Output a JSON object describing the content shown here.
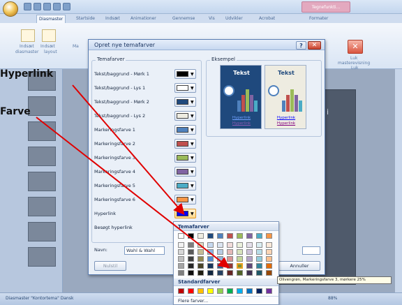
{
  "app": {
    "contextual_tab": "Tegnefunkti...",
    "tabs": [
      "Diasmaster",
      "Startside",
      "Indsæt",
      "Animationer",
      "Gennemse",
      "Vis",
      "Udvikler",
      "Acrobat",
      "Formater"
    ],
    "ribbon_items": {
      "insert_1": "Indsæt",
      "insert_2": "Indsæt",
      "diasmaster": "diasmaster",
      "layout": "layout",
      "ma": "Ma",
      "close_line1": "Luk",
      "close_line2": "masterevisning",
      "close_group": "Luk"
    },
    "slide_label": "ii",
    "status": {
      "left": "Diasmaster  \"Kontortema\"  Dansk",
      "zoom": "88%"
    }
  },
  "dialog": {
    "title": "Opret nye temafarver",
    "help": "?",
    "close": "✕",
    "temafarver_label": "Temafarver",
    "eksempel_label": "Eksempel",
    "rows": [
      {
        "label": "Tekst/baggrund - Mørk 1",
        "color": "#000000"
      },
      {
        "label": "Tekst/baggrund - Lys 1",
        "color": "#ffffff"
      },
      {
        "label": "Tekst/baggrund - Mørk 2",
        "color": "#1f497d"
      },
      {
        "label": "Tekst/baggrund - Lys 2",
        "color": "#eeece1"
      },
      {
        "label": "Markeringsfarve 1",
        "color": "#4f81bd"
      },
      {
        "label": "Markeringsfarve 2",
        "color": "#c0504d"
      },
      {
        "label": "Markeringsfarve 3",
        "color": "#9bbb59"
      },
      {
        "label": "Markeringsfarve 4",
        "color": "#8064a2"
      },
      {
        "label": "Markeringsfarve 5",
        "color": "#4bacc6"
      },
      {
        "label": "Markeringsfarve 6",
        "color": "#f79646"
      },
      {
        "label": "Hyperlink",
        "color": "#0000ff"
      },
      {
        "label": "Besøgt hyperlink",
        "color": ""
      }
    ],
    "preview": {
      "dark_title": "Tekst",
      "light_title": "Tekst",
      "link1": "Hyperlink",
      "link2": "Hyperlink",
      "light_link1": "Hyperlink",
      "light_link2": "Hyperlink"
    },
    "name_label": "Navn:",
    "name_value": "Wahl & Wahl",
    "reset_button": "Nulstil",
    "cancel_button": "Annuller"
  },
  "palette": {
    "theme_header": "Temafarver",
    "standard_header": "Standardfarver",
    "more_colors": "Flere farver...",
    "theme_columns": [
      "#ffffff",
      "#000000",
      "#eeece1",
      "#1f497d",
      "#4f81bd",
      "#c0504d",
      "#9bbb59",
      "#8064a2",
      "#4bacc6",
      "#f79646"
    ],
    "theme_shades": [
      [
        "#f2f2f2",
        "#7f7f7f",
        "#ddd9c3",
        "#c6d9f0",
        "#dbe5f1",
        "#f2dcdb",
        "#ebf1dd",
        "#e5e0ec",
        "#dbeef3",
        "#fdeada"
      ],
      [
        "#d8d8d8",
        "#595959",
        "#c4bd97",
        "#8db3e2",
        "#b8cce4",
        "#e5b9b7",
        "#d7e3bc",
        "#ccc1d9",
        "#b7dde8",
        "#fbd5b5"
      ],
      [
        "#bfbfbf",
        "#3f3f3f",
        "#938953",
        "#548dd4",
        "#95b3d7",
        "#d99694",
        "#c3d69b",
        "#b2a2c7",
        "#92cddc",
        "#fac08f"
      ],
      [
        "#a5a5a5",
        "#262626",
        "#494429",
        "#17365d",
        "#366092",
        "#953734",
        "#76923c",
        "#5f497a",
        "#31859b",
        "#e36c09"
      ],
      [
        "#7f7f7f",
        "#0c0c0c",
        "#1d1b10",
        "#0f243e",
        "#244061",
        "#632423",
        "#4f6128",
        "#3f3151",
        "#205867",
        "#974806"
      ]
    ],
    "standard_colors": [
      "#c00000",
      "#ff0000",
      "#ffc000",
      "#ffff00",
      "#92d050",
      "#00b050",
      "#00b0f0",
      "#0070c0",
      "#002060",
      "#7030a0"
    ],
    "tooltip": "Olivengrøn, Markeringsfarve 3, mørkere 25%"
  },
  "annotations": {
    "label1": "Hyperlink",
    "label2": "Farve",
    "arrow_color": "#e00000"
  }
}
